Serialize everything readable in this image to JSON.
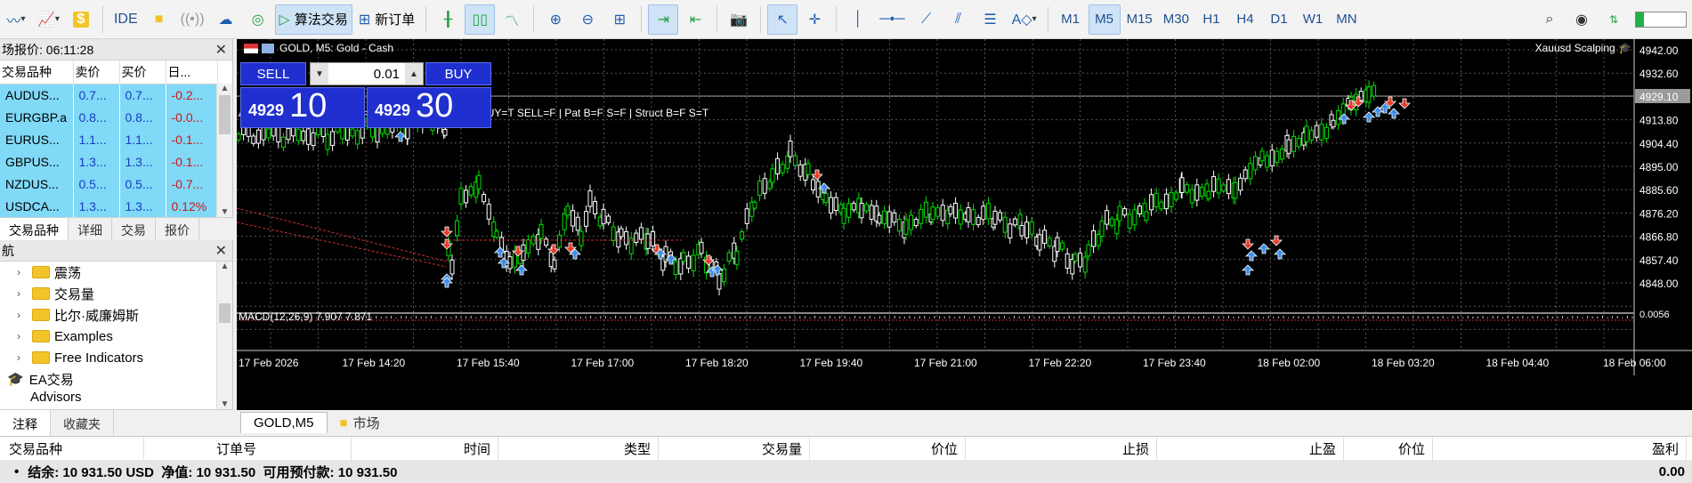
{
  "toolbar": {
    "algo_trading": "算法交易",
    "new_order": "新订单",
    "ide": "IDE",
    "timeframes": [
      "M1",
      "M5",
      "M15",
      "M30",
      "H1",
      "H4",
      "D1",
      "W1",
      "MN"
    ],
    "active_timeframe": "M5"
  },
  "market_watch": {
    "title": "场报价: 06:11:28",
    "columns": [
      "交易品种",
      "卖价",
      "买价",
      "日..."
    ],
    "rows": [
      {
        "symbol": "AUDUS...",
        "bid": "0.7...",
        "ask": "0.7...",
        "change": "-0.2..."
      },
      {
        "symbol": "EURGBP.a",
        "bid": "0.8...",
        "ask": "0.8...",
        "change": "-0.0..."
      },
      {
        "symbol": "EURUS...",
        "bid": "1.1...",
        "ask": "1.1...",
        "change": "-0.1..."
      },
      {
        "symbol": "GBPUS...",
        "bid": "1.3...",
        "ask": "1.3...",
        "change": "-0.1..."
      },
      {
        "symbol": "NZDUS...",
        "bid": "0.5...",
        "ask": "0.5...",
        "change": "-0.7..."
      },
      {
        "symbol": "USDCA...",
        "bid": "1.3...",
        "ask": "1.3...",
        "change": "0.12%"
      }
    ],
    "tabs": [
      "交易品种",
      "详细",
      "交易",
      "报价"
    ]
  },
  "navigator": {
    "title": "航",
    "items": [
      "震荡",
      "交易量",
      "比尔·威廉姆斯",
      "Examples",
      "Free Indicators"
    ],
    "ea_label": "EA交易",
    "advisors": "Advisors",
    "tabs": [
      "注释",
      "收藏夹"
    ]
  },
  "chart": {
    "header": "GOLD, M5: Gold - Cash",
    "expert": "Xauusd Scalping",
    "info_line": "ATR=978.7 pips | ATR_OK=T | Regime=Trending | BUY=T SELL=F | Pat B=F S=F | Struct B=F S=T",
    "macd": "MACD(12,26,9) 7.907 7.871",
    "sell_label": "SELL",
    "buy_label": "BUY",
    "volume": "0.01",
    "sell_small": "4929",
    "sell_big": "10",
    "buy_small": "4929",
    "buy_big": "30",
    "price_labels": [
      "4942.00",
      "4932.60",
      "4923.20",
      "4913.80",
      "4904.40",
      "4895.00",
      "4885.60",
      "4876.20",
      "4866.80",
      "4857.40",
      "4848.00"
    ],
    "current_price": "4929.10",
    "macd_max": "0.0056",
    "time_labels": [
      "17 Feb 2026",
      "17 Feb 14:20",
      "17 Feb 15:40",
      "17 Feb 17:00",
      "17 Feb 18:20",
      "17 Feb 19:40",
      "17 Feb 21:00",
      "17 Feb 22:20",
      "17 Feb 23:40",
      "18 Feb 02:00",
      "18 Feb 03:20",
      "18 Feb 04:40",
      "18 Feb 06:00"
    ],
    "tabs": [
      "GOLD,M5",
      "市场"
    ]
  },
  "terminal": {
    "columns": [
      "交易品种",
      "订单号",
      "时间",
      "类型",
      "交易量",
      "价位",
      "止损",
      "止盈",
      "价位",
      "盈利"
    ],
    "balance_line": "结余: 10 931.50 USD  净值: 10 931.50  可用预付款: 10 931.50",
    "profit": "0.00"
  },
  "colors": {
    "bull": "#00e000",
    "bear": "#ffffff",
    "background": "#000000",
    "panel_blue": "#1f2fd0",
    "watch_row": "#7fd9f7"
  }
}
